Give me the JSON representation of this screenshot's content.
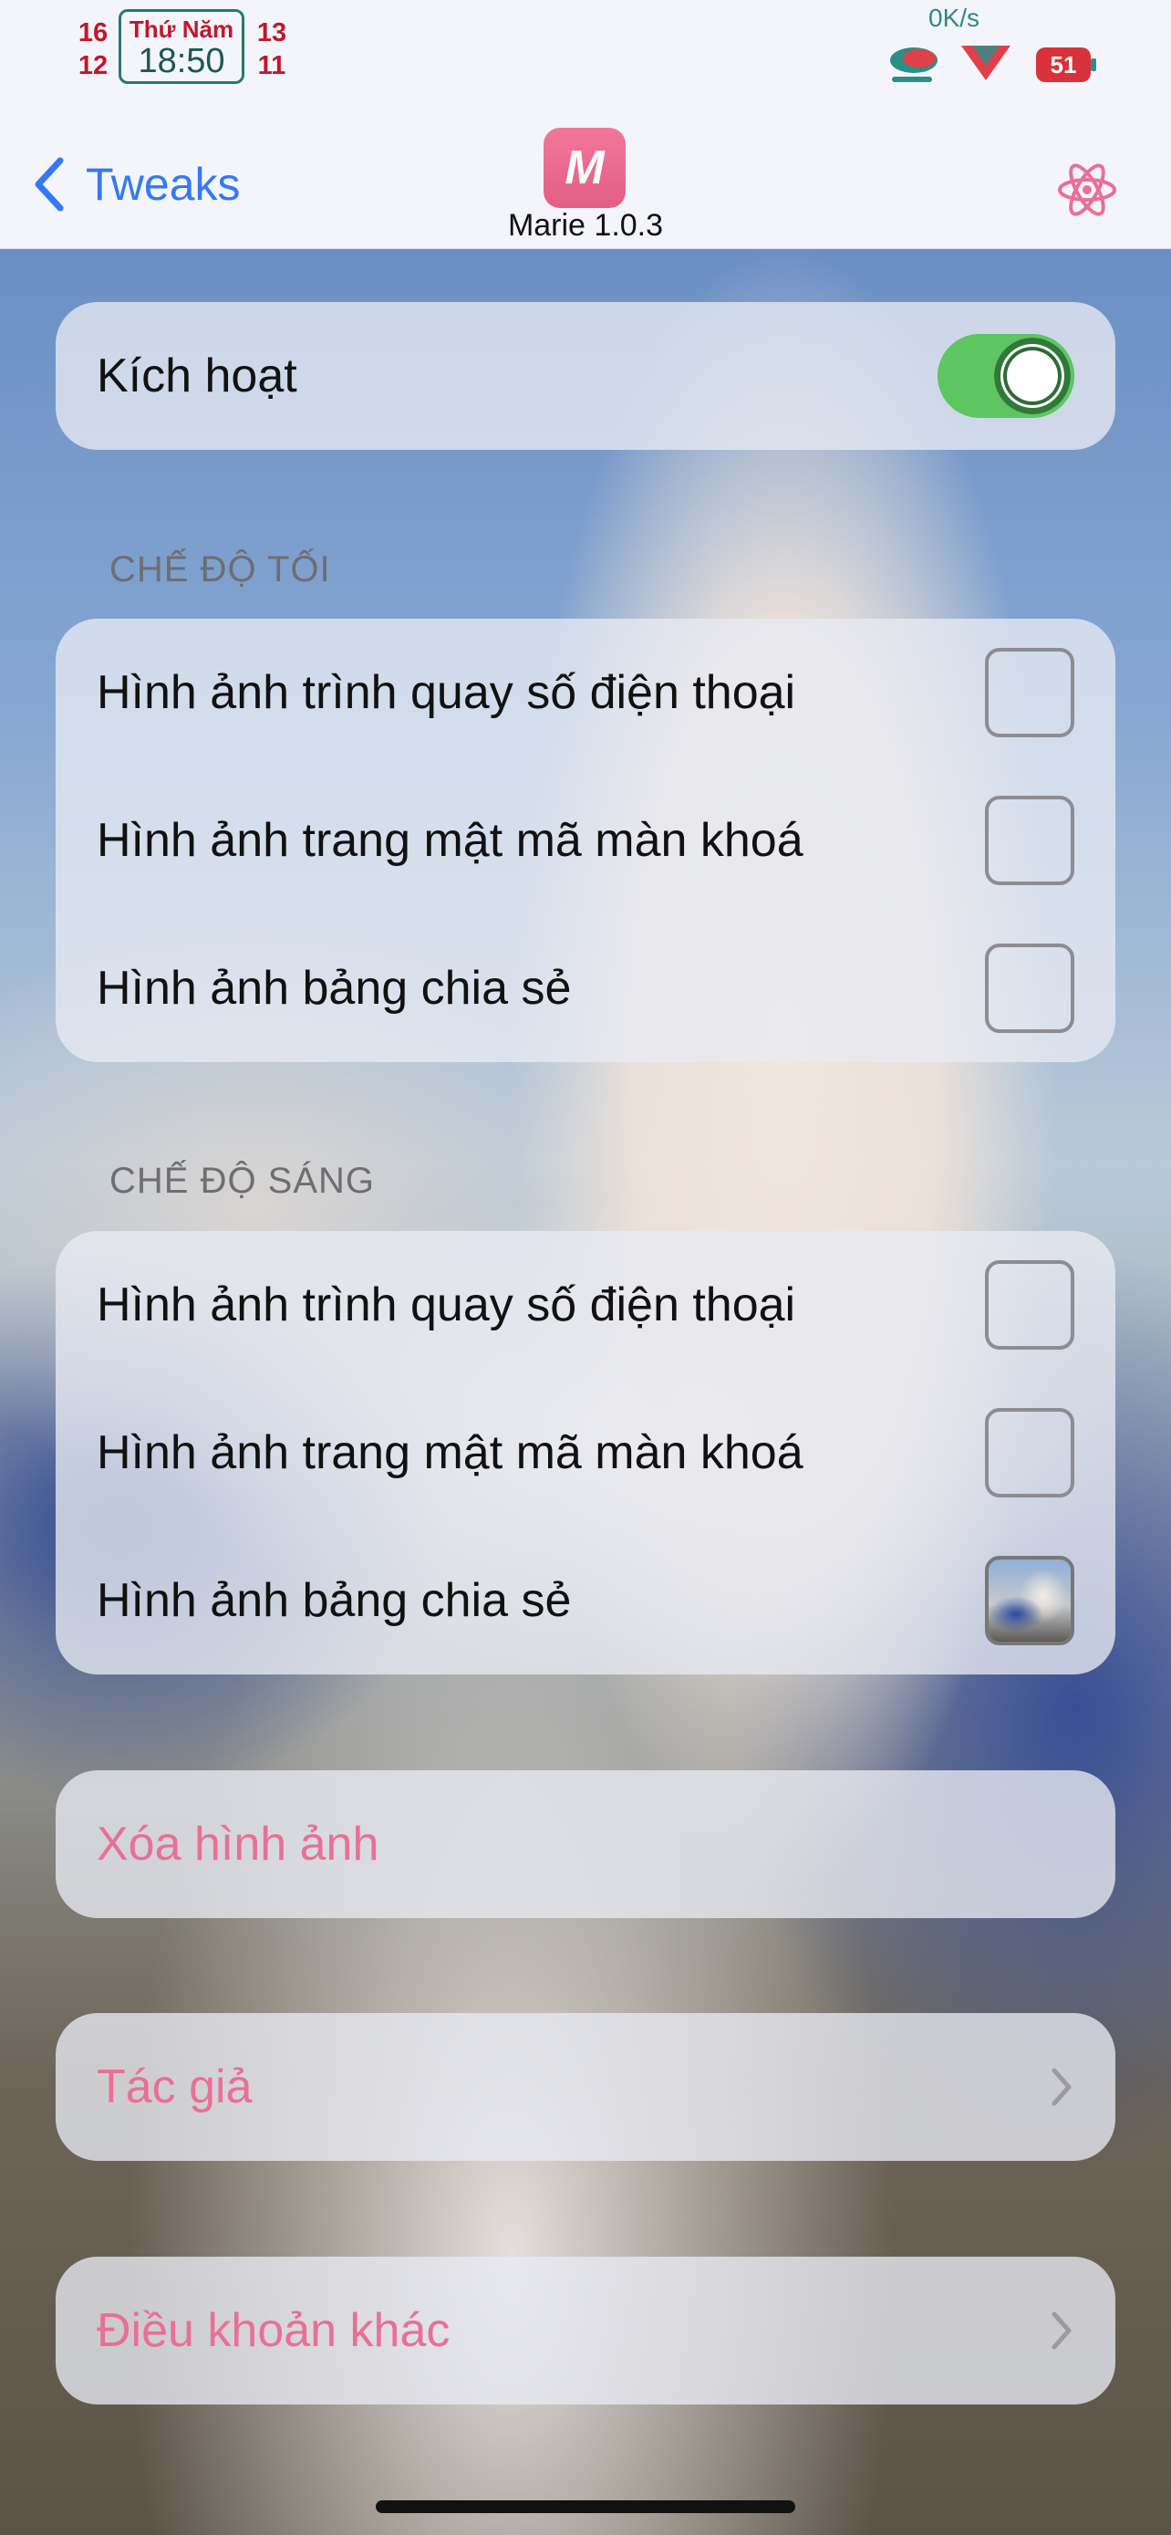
{
  "status_bar": {
    "cal_left_top": "16",
    "cal_left_bottom": "12",
    "day": "Thứ Năm",
    "time": "18:50",
    "cal_right_top": "13",
    "cal_right_bottom": "11",
    "net_speed": "0K/s",
    "battery": "51"
  },
  "nav": {
    "back_label": "Tweaks",
    "app_name": "Marie 1.0.3",
    "logo_glyph": "M"
  },
  "main": {
    "enable": {
      "label": "Kích hoạt",
      "on": true
    },
    "dark_mode": {
      "header": "CHẾ ĐỘ TỐI",
      "items": [
        {
          "label": "Hình ảnh trình quay số điện thoại",
          "checked": false
        },
        {
          "label": "Hình ảnh trang mật mã màn khoá",
          "checked": false
        },
        {
          "label": "Hình ảnh bảng chia sẻ",
          "checked": false
        }
      ]
    },
    "light_mode": {
      "header": "CHẾ ĐỘ SÁNG",
      "items": [
        {
          "label": "Hình ảnh trình quay số điện thoại",
          "checked": false
        },
        {
          "label": "Hình ảnh trang mật mã màn khoá",
          "checked": false
        },
        {
          "label": "Hình ảnh bảng chia sẻ",
          "checked": true
        }
      ]
    },
    "delete_label": "Xóa hình ảnh",
    "author_label": "Tác giả",
    "terms_label": "Điều khoản khác"
  },
  "colors": {
    "accent_blue": "#3478f6",
    "pink": "#ea6f95",
    "toggle_green": "#5dc660"
  }
}
